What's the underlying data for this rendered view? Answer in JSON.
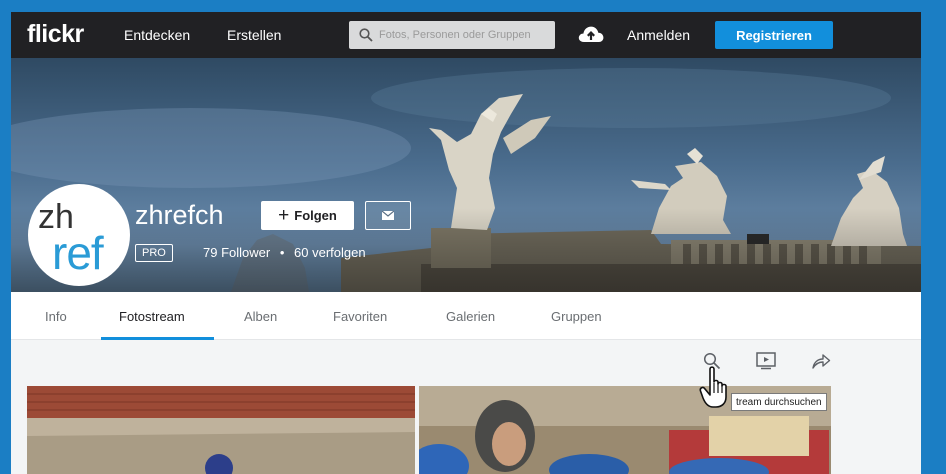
{
  "nav": {
    "logo": "flickr",
    "explore": "Entdecken",
    "create": "Erstellen",
    "search_placeholder": "Fotos, Personen oder Gruppen",
    "signin": "Anmelden",
    "register": "Registrieren"
  },
  "profile": {
    "avatar_line1": "zh",
    "avatar_line2": "ref",
    "username": "zhrefch",
    "follow_label": "Folgen",
    "pro_badge": "PRO",
    "followers": "79 Follower",
    "separator": "•",
    "following": "60 verfolgen"
  },
  "tabs": [
    {
      "label": "Info"
    },
    {
      "label": "Fotostream"
    },
    {
      "label": "Alben"
    },
    {
      "label": "Favoriten"
    },
    {
      "label": "Galerien"
    },
    {
      "label": "Gruppen"
    }
  ],
  "active_tab": "Fotostream",
  "tools": {
    "tooltip": "tream durchsuchen"
  },
  "colors": {
    "nav_bg": "#212124",
    "accent": "#128fdc",
    "page_bg": "#f3f5f6",
    "frame": "#1b7ec4"
  },
  "icons": {
    "search": "search-icon",
    "upload": "cloud-upload-icon",
    "mail": "mail-icon",
    "slideshow": "slideshow-icon",
    "share": "share-icon",
    "cursor": "hand-pointer-icon"
  }
}
